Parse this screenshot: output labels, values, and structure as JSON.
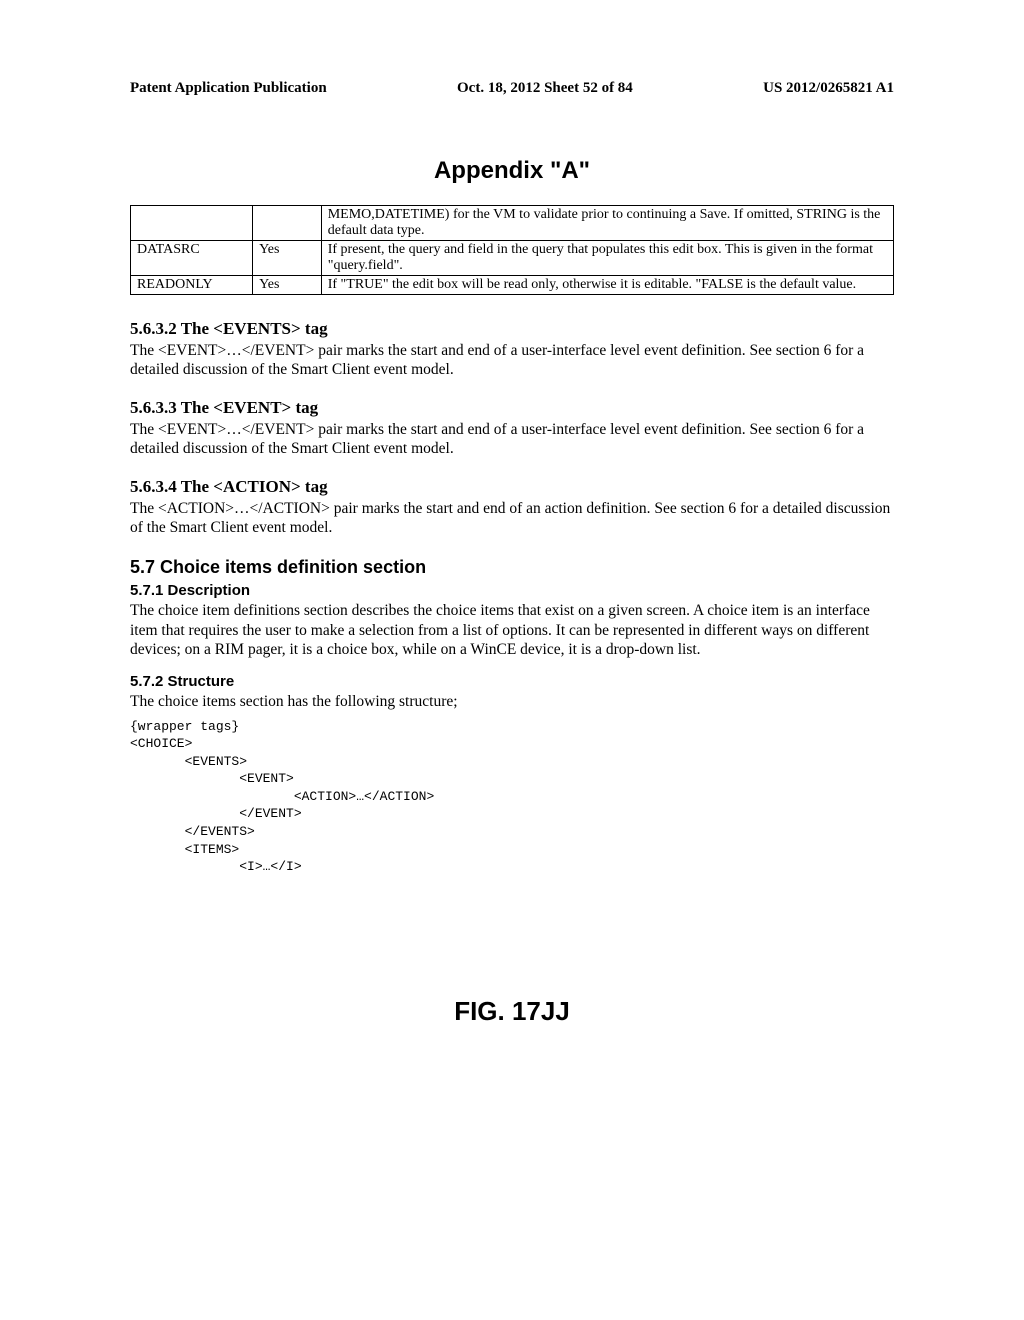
{
  "header": {
    "left": "Patent Application Publication",
    "center": "Oct. 18, 2012  Sheet 52 of 84",
    "right": "US 2012/0265821 A1"
  },
  "appendix_title": "Appendix \"A\"",
  "table": {
    "rows": [
      {
        "c1": "",
        "c2": "",
        "c3": "MEMO,DATETIME) for the VM to validate prior to continuing a Save. If omitted, STRING is the default data type."
      },
      {
        "c1": "DATASRC",
        "c2": "Yes",
        "c3": "If present, the query and field in the query that populates this edit box. This is given in the format \"query.field\"."
      },
      {
        "c1": "READONLY",
        "c2": "Yes",
        "c3": "If  \"TRUE\" the edit box will be read only, otherwise it is editable. \"FALSE is the default value."
      }
    ]
  },
  "sections": {
    "s5632": {
      "heading": "5.6.3.2  The <EVENTS> tag",
      "body": "The <EVENT>…</EVENT> pair marks the start and end of a user-interface level event definition. See section 6 for a detailed discussion of the Smart Client event model."
    },
    "s5633": {
      "heading": "5.6.3.3  The <EVENT> tag",
      "body": "The <EVENT>…</EVENT> pair marks the start and end of a user-interface level event definition. See section 6 for a detailed discussion of the Smart Client event model."
    },
    "s5634": {
      "heading": "5.6.3.4  The <ACTION> tag",
      "body": "The <ACTION>…</ACTION> pair marks the start and end of an action definition. See section 6 for a detailed discussion of the Smart Client event model."
    },
    "s57": {
      "heading": "5.7  Choice items definition section"
    },
    "s571": {
      "heading": "5.7.1  Description",
      "body": "The choice item definitions section describes the choice items that exist on a given screen. A choice item is an interface item that requires the user to make a selection from a list of options. It can be represented in different ways on different devices; on a RIM pager, it is a choice box, while on a WinCE device, it is a drop-down list."
    },
    "s572": {
      "heading": "5.7.2  Structure",
      "body": "The choice items section has the following structure;",
      "code": "{wrapper tags}\n<CHOICE>\n       <EVENTS>\n              <EVENT>\n                     <ACTION>…</ACTION>\n              </EVENT>\n       </EVENTS>\n       <ITEMS>\n              <I>…</I>"
    }
  },
  "figure_label": "FIG. 17JJ"
}
